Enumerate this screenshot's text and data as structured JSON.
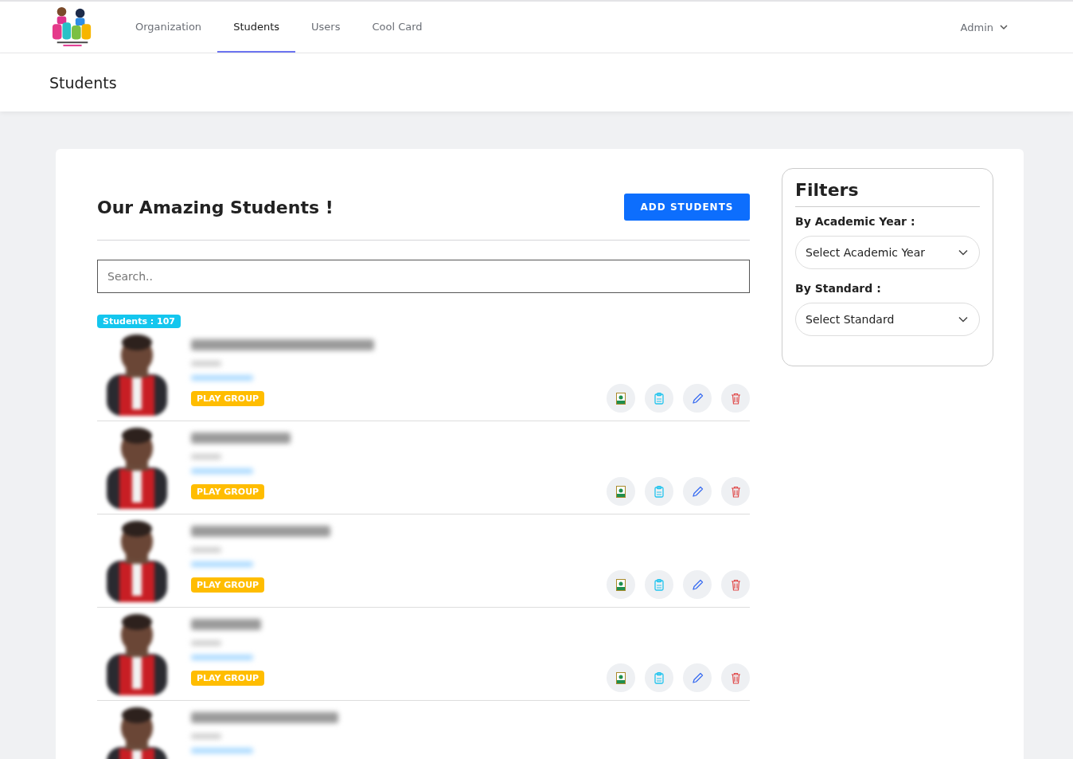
{
  "nav": {
    "items": [
      {
        "label": "Organization",
        "selected": false
      },
      {
        "label": "Students",
        "selected": true
      },
      {
        "label": "Users",
        "selected": false
      },
      {
        "label": "Cool Card",
        "selected": false
      }
    ],
    "user_menu": "Admin"
  },
  "page_title": "Students",
  "list": {
    "heading": "Our Amazing Students !",
    "add_button": "ADD STUDENTS",
    "search": {
      "placeholder": "Search.."
    },
    "count_badge": "Students : 107",
    "students": [
      {
        "kind": "full",
        "standard": "PLAY GROUP"
      },
      {
        "kind": "full",
        "standard": "PLAY GROUP"
      },
      {
        "kind": "full",
        "standard": "PLAY GROUP"
      },
      {
        "kind": "full",
        "standard": "PLAY GROUP"
      },
      {
        "kind": "partial"
      }
    ]
  },
  "filters": {
    "title": "Filters",
    "groups": [
      {
        "label": "By Academic Year :",
        "placeholder": "Select Academic Year"
      },
      {
        "label": "By Standard :",
        "placeholder": "Select Standard"
      }
    ]
  }
}
